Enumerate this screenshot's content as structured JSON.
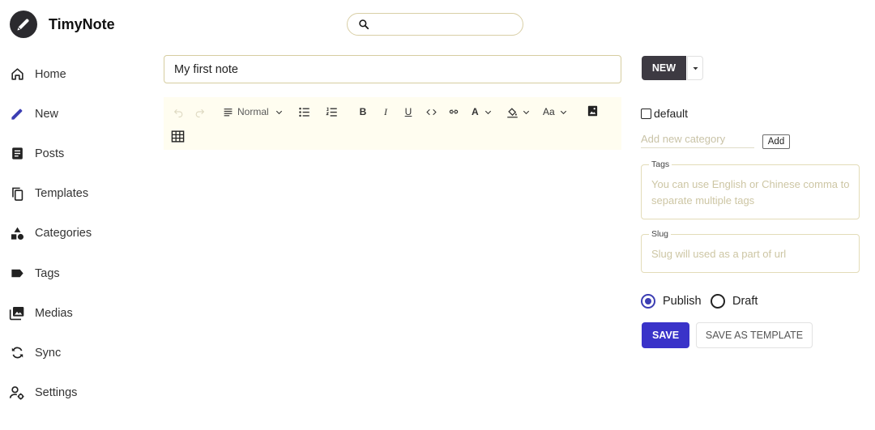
{
  "app": {
    "title": "TimyNote",
    "logo_icon": "pencil-icon"
  },
  "search": {
    "value": "",
    "placeholder": "",
    "icon": "search-icon"
  },
  "sidebar": {
    "items": [
      {
        "label": "Home",
        "icon": "home-icon"
      },
      {
        "label": "New",
        "icon": "pencil-icon",
        "active": true
      },
      {
        "label": "Posts",
        "icon": "article-icon"
      },
      {
        "label": "Templates",
        "icon": "copy-icon"
      },
      {
        "label": "Categories",
        "icon": "category-icon"
      },
      {
        "label": "Tags",
        "icon": "label-icon"
      },
      {
        "label": "Medias",
        "icon": "photo-library-icon"
      },
      {
        "label": "Sync",
        "icon": "sync-icon"
      },
      {
        "label": "Settings",
        "icon": "user-settings-icon"
      }
    ]
  },
  "editor": {
    "title_value": "My first note",
    "toolbar": {
      "heading_select": "Normal",
      "font_size_select": "Aa"
    }
  },
  "panel": {
    "new_button": "NEW",
    "category_default": "default",
    "category_input_placeholder": "Add new category",
    "add_button": "Add",
    "tags_legend": "Tags",
    "tags_placeholder": "You can use English or Chinese comma to separate multiple tags",
    "slug_legend": "Slug",
    "slug_placeholder": "Slug will used as a part of url",
    "status_options": [
      {
        "label": "Publish",
        "selected": true
      },
      {
        "label": "Draft",
        "selected": false
      }
    ],
    "save_button": "SAVE",
    "save_template_button": "SAVE AS TEMPLATE"
  },
  "colors": {
    "accent": "#3a33c9",
    "dark_button": "#3d3a42",
    "toolbar_bg": "#fffdf0"
  }
}
